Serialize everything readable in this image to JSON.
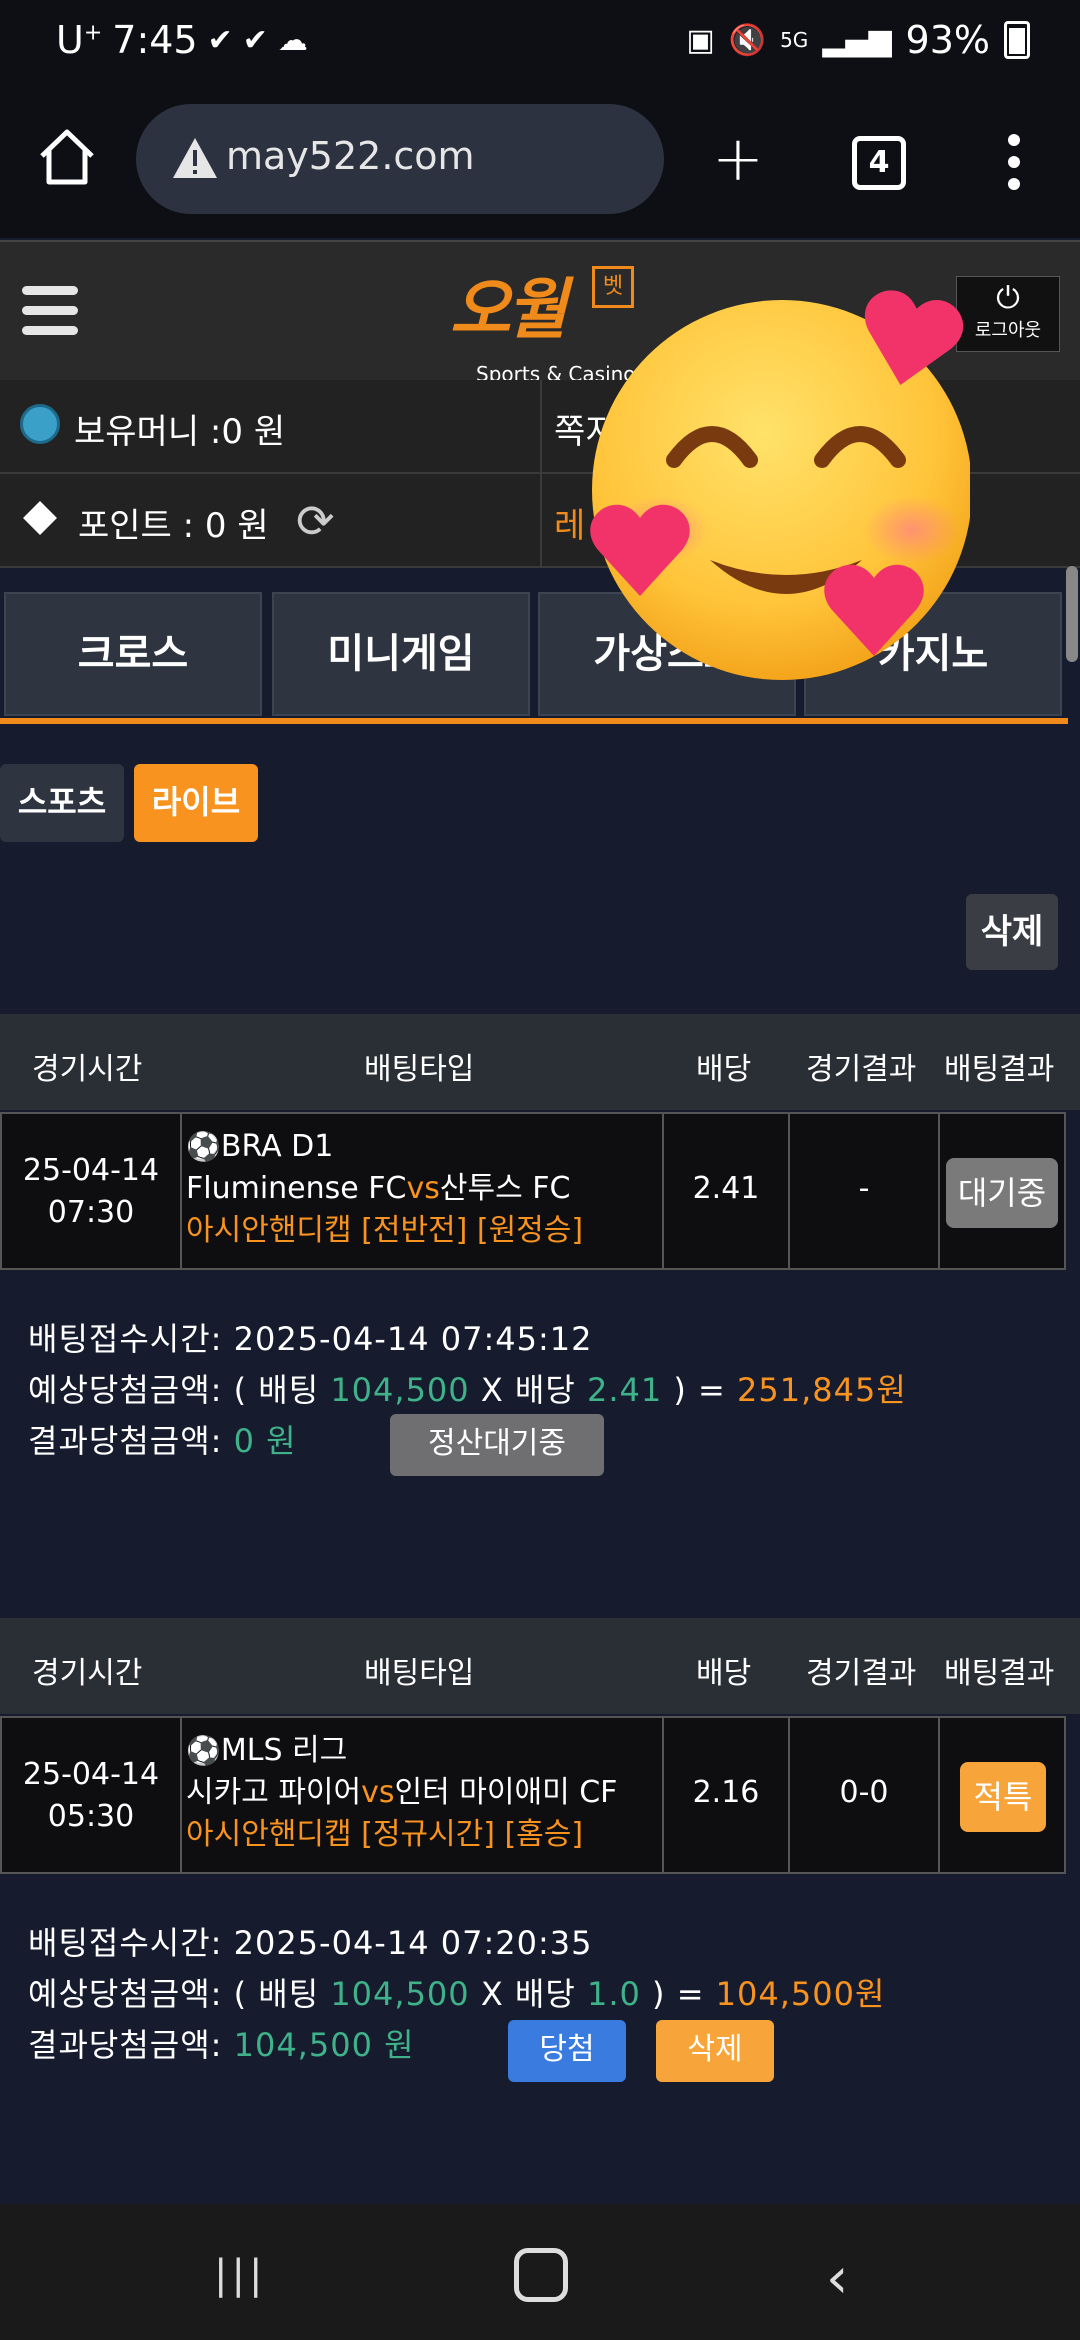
{
  "status_bar": {
    "carrier": "U",
    "carrier_sup": "+",
    "time": "7:45",
    "icons_left": [
      "check-icon",
      "check-icon",
      "cloud-icon"
    ],
    "icons_right": [
      "nfc-icon",
      "mute-icon",
      "5g-icon",
      "signal-icon",
      "battery-icon"
    ],
    "network": "5G",
    "battery": "93%"
  },
  "browser": {
    "url": "may522.com",
    "tab_count": "4"
  },
  "site": {
    "logo_sub": "Sports & Casino",
    "logout_label": "로그아웃",
    "money_label": "보유머니 :0 원",
    "memo_label": "쪽지",
    "point_label": "포인트 :",
    "point_value": "0 원",
    "level_label": "레"
  },
  "top_tabs": [
    {
      "label": "크로스"
    },
    {
      "label": "미니게임"
    },
    {
      "label": "가상스포"
    },
    {
      "label": "카지노"
    }
  ],
  "sub_tabs": {
    "sports": "스포츠",
    "live": "라이브"
  },
  "delete_top": "삭제",
  "table_headers": {
    "time": "경기시간",
    "bet_type": "배팅타입",
    "odds": "배당",
    "game_result": "경기결과",
    "bet_result": "배팅결과"
  },
  "bets": [
    {
      "date": "25-04-14",
      "time": "07:30",
      "league": "BRA D1",
      "home": "Fluminense FC",
      "vs": "vs",
      "away": "산투스 FC",
      "market": "아시안핸디캡 [전반전] [원정승]",
      "odds": "2.41",
      "result": "-",
      "status": "대기중",
      "status_color": "#7a7a7a",
      "accept_label": "배팅접수시간: ",
      "accept_time": "2025-04-14 07:45:12",
      "expected_label": "예상당첨금액: ( 배팅 ",
      "stake": "104,500",
      "x_label": " X 배당 ",
      "odds2": "2.41",
      "eq_label": " ) = ",
      "expected": "251,845원",
      "final_label": "결과당첨금액: ",
      "final": "0 원",
      "action1": "정산대기중"
    },
    {
      "date": "25-04-14",
      "time": "05:30",
      "league": "MLS 리그",
      "home": "시카고 파이어",
      "vs": "vs",
      "away": "인터 마이애미 CF",
      "market": "아시안핸디캡 [정규시간] [홈승]",
      "odds": "2.16",
      "result": "0-0",
      "status": "적특",
      "status_color": "#f7a53a",
      "accept_label": "배팅접수시간: ",
      "accept_time": "2025-04-14 07:20:35",
      "expected_label": "예상당첨금액: ( 배팅 ",
      "stake": "104,500",
      "x_label": " X 배당 ",
      "odds2": "1.0",
      "eq_label": " ) = ",
      "expected": "104,500원",
      "final_label": "결과당첨금액: ",
      "final": "104,500 원",
      "action1": "당첨",
      "action2": "삭제"
    }
  ],
  "colors": {
    "accent": "#f7931e",
    "green_text": "#3fb28a",
    "win_button": "#3a7be0",
    "background": "#161b2e"
  }
}
